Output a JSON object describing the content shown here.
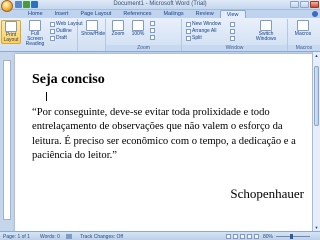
{
  "window": {
    "title": "Document1 - Microsoft Word (Trial)"
  },
  "tabs": [
    "Home",
    "Insert",
    "Page Layout",
    "References",
    "Mailings",
    "Review",
    "View"
  ],
  "active_tab": "View",
  "ribbon": {
    "print_layout": "Print Layout",
    "full_screen_reading": "Full Screen Reading",
    "web_layout": "Web Layout",
    "outline": "Outline",
    "draft": "Draft",
    "show_hide": "Show/Hide",
    "zoom": "Zoom",
    "zoom_percent": "100%",
    "new_window": "New Window",
    "arrange_all": "Arrange All",
    "split": "Split",
    "switch_windows": "Switch Windows",
    "macros": "Macros",
    "group_zoom": "Zoom",
    "group_window": "Window",
    "group_macros": "Macros"
  },
  "document": {
    "heading": "Seja conciso",
    "body": "“Por conseguinte, deve-se evitar toda prolixidade e todo entrelaçamento de observações que não valem o esforço da leitura. É preciso ser econômico com o tempo, a dedicação e a paciência do leitor.”",
    "author": "Schopenhauer"
  },
  "status": {
    "page": "Page: 1 of 1",
    "words": "Words: 0",
    "track_changes": "Track Changes: Off",
    "zoom": "80%"
  }
}
